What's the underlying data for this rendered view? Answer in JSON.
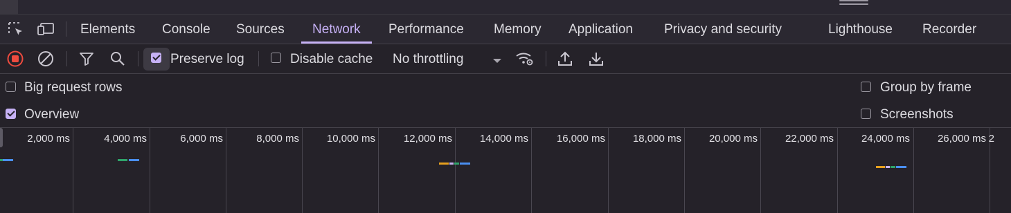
{
  "tabs": [
    {
      "label": "Elements"
    },
    {
      "label": "Console"
    },
    {
      "label": "Sources"
    },
    {
      "label": "Network",
      "active": true
    },
    {
      "label": "Performance"
    },
    {
      "label": "Memory"
    },
    {
      "label": "Application"
    },
    {
      "label": "Privacy and security"
    },
    {
      "label": "Lighthouse"
    },
    {
      "label": "Recorder"
    }
  ],
  "toolbar": {
    "preserve_log": {
      "label": "Preserve log",
      "checked": true
    },
    "disable_cache": {
      "label": "Disable cache",
      "checked": false
    },
    "throttling": "No throttling"
  },
  "options": {
    "big_request_rows": {
      "label": "Big request rows",
      "checked": false
    },
    "overview": {
      "label": "Overview",
      "checked": true
    },
    "group_by_frame": {
      "label": "Group by frame",
      "checked": false
    },
    "screenshots": {
      "label": "Screenshots",
      "checked": false
    }
  },
  "timeline": {
    "ticks": [
      "2,000 ms",
      "4,000 ms",
      "6,000 ms",
      "8,000 ms",
      "10,000 ms",
      "12,000 ms",
      "14,000 ms",
      "16,000 ms",
      "18,000 ms",
      "20,000 ms",
      "22,000 ms",
      "24,000 ms",
      "26,000 ms",
      "2"
    ],
    "colors": {
      "waiting": "#e6a01e",
      "queue": "#c9b4f0",
      "connect": "#2fa46a",
      "download": "#4a8ff0"
    }
  },
  "icons": [
    "select-element-icon",
    "device-toolbar-icon",
    "record-stop-icon",
    "clear-icon",
    "filter-icon",
    "search-icon",
    "dropdown-caret-icon",
    "network-conditions-icon",
    "import-har-icon",
    "export-har-icon"
  ]
}
